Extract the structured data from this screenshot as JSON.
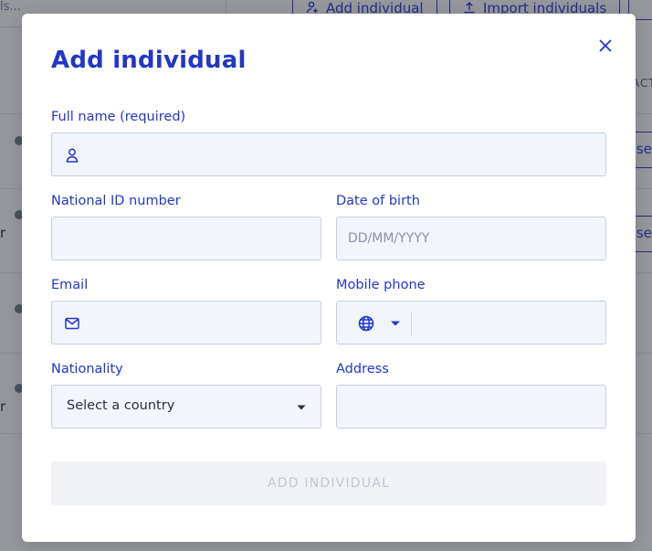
{
  "background": {
    "search_text": "ls...",
    "add_individual_button": "Add individual",
    "import_individuals_button": "Import individuals",
    "column_header_partial": "ACT",
    "row_button_partial": "sse",
    "row_letters": [
      "r",
      "r"
    ]
  },
  "modal": {
    "title": "Add individual",
    "close_icon": "close-icon",
    "fields": {
      "full_name": {
        "label": "Full name (required)",
        "value": "",
        "placeholder": "",
        "icon": "person-icon"
      },
      "national_id": {
        "label": "National ID number",
        "value": "",
        "placeholder": ""
      },
      "date_of_birth": {
        "label": "Date of birth",
        "value": "",
        "placeholder": "DD/MM/YYYY"
      },
      "email": {
        "label": "Email",
        "value": "",
        "placeholder": "",
        "icon": "mail-icon"
      },
      "mobile_phone": {
        "label": "Mobile phone",
        "value": "",
        "placeholder": "",
        "prefix_icon": "globe-icon"
      },
      "nationality": {
        "label": "Nationality",
        "selected": "Select a country"
      },
      "address": {
        "label": "Address",
        "value": "",
        "placeholder": ""
      }
    },
    "submit_label": "ADD INDIVIDUAL"
  },
  "colors": {
    "accent": "#2236c9",
    "field_bg": "#f3f5fd",
    "field_border": "#c8cde3",
    "disabled_bg": "#f1f2f5",
    "disabled_text": "#c4c7d1"
  }
}
